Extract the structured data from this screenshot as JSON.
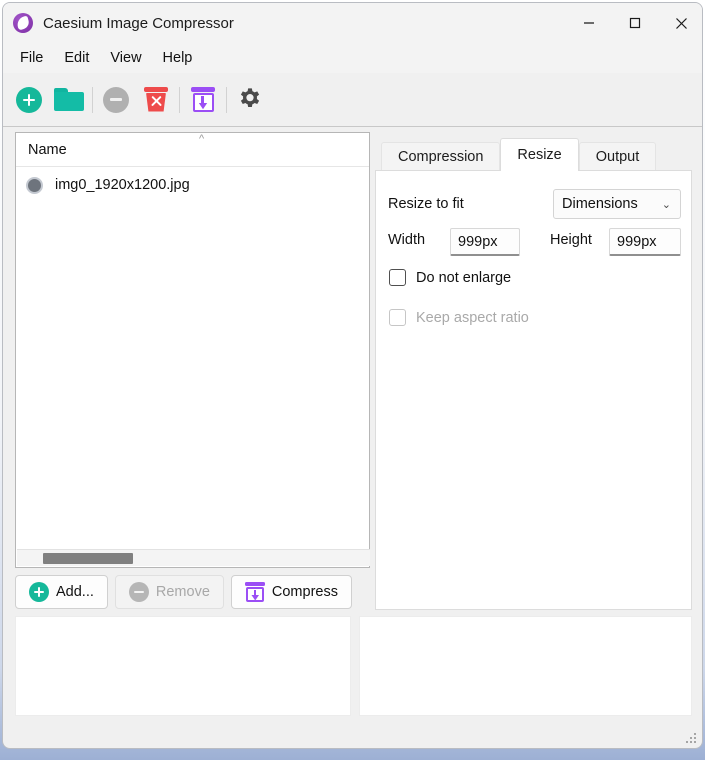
{
  "window": {
    "title": "Caesium Image Compressor",
    "icon": "caesium-app-icon",
    "controls": {
      "minimize": "minimize-icon",
      "maximize": "maximize-icon",
      "close": "close-icon"
    }
  },
  "menubar": {
    "items": [
      {
        "label": "File"
      },
      {
        "label": "Edit"
      },
      {
        "label": "View"
      },
      {
        "label": "Help"
      }
    ]
  },
  "toolbar": {
    "buttons": [
      {
        "name": "add-files-button",
        "icon": "plus-circle-icon",
        "enabled": true
      },
      {
        "name": "add-folder-button",
        "icon": "folder-icon",
        "enabled": true
      },
      {
        "name": "remove-button",
        "icon": "minus-circle-icon",
        "enabled": false
      },
      {
        "name": "clear-list-button",
        "icon": "trash-x-icon",
        "enabled": true
      },
      {
        "name": "compress-button",
        "icon": "compress-box-icon",
        "enabled": true
      },
      {
        "name": "settings-button",
        "icon": "gear-icon",
        "enabled": true
      }
    ]
  },
  "file_list": {
    "column_header": "Name",
    "sort_indicator": "chevron-up-icon",
    "rows": [
      {
        "thumbnail": "image-placeholder-icon",
        "name": "img0_1920x1200.jpg"
      }
    ],
    "scrollbar": "horizontal-scrollbar"
  },
  "actions": {
    "add": {
      "label": "Add...",
      "icon": "plus-circle-icon",
      "enabled": true
    },
    "remove": {
      "label": "Remove",
      "icon": "minus-circle-icon",
      "enabled": false
    },
    "compress": {
      "label": "Compress",
      "icon": "compress-box-icon",
      "enabled": true
    }
  },
  "tabs": {
    "items": [
      {
        "label": "Compression",
        "active": false
      },
      {
        "label": "Resize",
        "active": true
      },
      {
        "label": "Output",
        "active": false
      }
    ]
  },
  "resize_panel": {
    "resize_to_fit_label": "Resize to fit",
    "mode_select": {
      "value": "Dimensions",
      "chevron": "chevron-down-icon"
    },
    "width_label": "Width",
    "width_value": "999px",
    "height_label": "Height",
    "height_value": "999px",
    "do_not_enlarge": {
      "label": "Do not enlarge",
      "checked": false,
      "enabled": true
    },
    "keep_aspect_ratio": {
      "label": "Keep aspect ratio",
      "checked": false,
      "enabled": false
    }
  },
  "preview": {
    "original_pane": "original-preview",
    "compressed_pane": "compressed-preview"
  },
  "colors": {
    "accent_teal": "#15b89a",
    "accent_purple": "#9b4ef5",
    "accent_red": "#ee4b4b",
    "disabled_gray": "#b0b0b0",
    "window_bg": "#f0f0f0",
    "titlebar_bg": "#f3f3f3"
  },
  "statusbar": {
    "resize_grip": "resize-grip-icon"
  }
}
